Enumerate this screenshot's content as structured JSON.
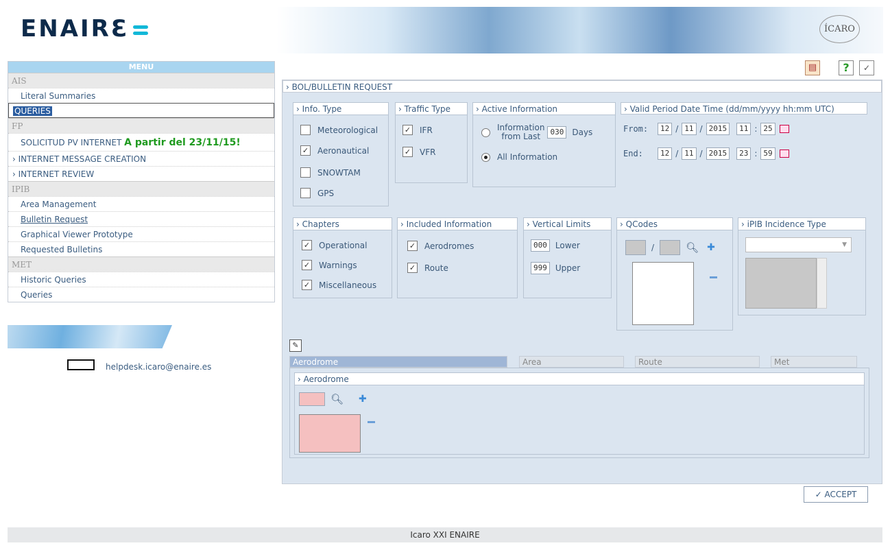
{
  "header": {
    "logo": "ENAIRƐ",
    "brand": "ÍCARO"
  },
  "menu": {
    "title": "MENU",
    "sections": {
      "ais": "AIS",
      "fp": "FP",
      "ipib": "IPIB",
      "met": "MET"
    },
    "literal_summaries": "Literal Summaries",
    "queries_ais": "QUERIES",
    "solicitud": "SOLICITUD PV INTERNET",
    "solicitud_note": "A partir del 23/11/15!",
    "internet_message": "INTERNET MESSAGE CREATION",
    "internet_review": "INTERNET REVIEW",
    "area_management": "Area Management",
    "bulletin_request": "Bulletin Request",
    "graphical_viewer": "Graphical Viewer Prototype",
    "requested_bulletins": "Requested Bulletins",
    "historic_queries": "Historic Queries",
    "queries_met": "Queries"
  },
  "helpdesk": "helpdesk.icaro@enaire.es",
  "toolbar": {
    "help": "?",
    "check": "✓"
  },
  "form": {
    "title": "BOL/BULLETIN REQUEST",
    "info_type": {
      "title": "Info. Type",
      "options": [
        "Meteorological",
        "Aeronautical",
        "SNOWTAM",
        "GPS"
      ],
      "checked": [
        false,
        true,
        false,
        false
      ]
    },
    "traffic_type": {
      "title": "Traffic Type",
      "options": [
        "IFR",
        "VFR"
      ],
      "checked": [
        true,
        true
      ]
    },
    "active_info": {
      "title": "Active Information",
      "option1_line1": "Information",
      "option1_line2": "from Last",
      "days_value": "030",
      "days_label": "Days",
      "option2": "All Information",
      "selected": "All Information"
    },
    "valid_period": {
      "title": "Valid Period Date Time (dd/mm/yyyy hh:mm UTC)",
      "from_label": "From:",
      "from": {
        "dd": "12",
        "mm": "11",
        "yyyy": "2015",
        "hh": "11",
        "mi": "25"
      },
      "end_label": "End:",
      "end": {
        "dd": "12",
        "mm": "11",
        "yyyy": "2015",
        "hh": "23",
        "mi": "59"
      },
      "sep_date": "/",
      "sep_time": ":"
    },
    "chapters": {
      "title": "Chapters",
      "options": [
        "Operational",
        "Warnings",
        "Miscellaneous"
      ],
      "checked": [
        true,
        true,
        true
      ]
    },
    "included_info": {
      "title": "Included Information",
      "options": [
        "Aerodromes",
        "Route"
      ],
      "checked": [
        true,
        true
      ]
    },
    "vertical_limits": {
      "title": "Vertical Limits",
      "lower_value": "000",
      "lower_label": "Lower",
      "upper_value": "999",
      "upper_label": "Upper"
    },
    "qcodes": {
      "title": "QCodes",
      "sep": "/"
    },
    "ipib": {
      "title": "iPIB Incidence Type"
    },
    "tabs": [
      "Aerodrome",
      "Area",
      "Route",
      "Met"
    ],
    "aerodrome_box_title": "Aerodrome",
    "accept": "✓ ACCEPT"
  },
  "footer": "Icaro XXI ENAIRE",
  "colors": {
    "accent": "#2b5da0",
    "panel": "#dbe5f0",
    "menu_header": "#a9d5f0",
    "green_note": "#1f9a1f"
  }
}
